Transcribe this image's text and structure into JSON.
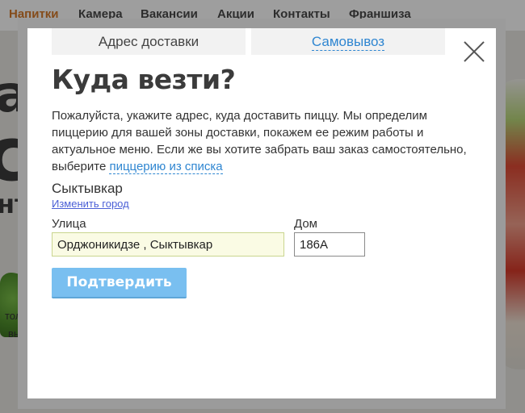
{
  "nav": {
    "items": [
      "Напитки",
      "Камера",
      "Вакансии",
      "Акции",
      "Контакты",
      "Франшиза"
    ],
    "active_color": "#d67a2a",
    "color": "#4a4a4a"
  },
  "background": {
    "fragment_1": "а",
    "fragment_2": "с",
    "fragment_3": "нт",
    "fragment_4": "толь",
    "fragment_5": "выс"
  },
  "modal": {
    "tabs": [
      {
        "label": "Адрес доставки",
        "active": true
      },
      {
        "label": "Самовывоз",
        "active": false
      }
    ],
    "close_icon": "close-icon",
    "title": "Куда везти?",
    "description": "Пожалуйста, укажите адрес, куда доставить пиццу. Мы определим пиццерию для вашей зоны доставки, покажем ее режим работы и актуальное меню. Если же вы хотите забрать ваш заказ самостоятельно, выберите",
    "description_link": "пиццерию из списка",
    "city": "Сыктывкар",
    "change_city_link": "Изменить город",
    "street_label": "Улица",
    "street_value": "Орджоникидзе , Сыктывкар",
    "house_label": "Дом",
    "house_value": "186А",
    "confirm_label": "Подтвердить",
    "link_color": "#2f86d1",
    "button_color": "#79bff0"
  }
}
